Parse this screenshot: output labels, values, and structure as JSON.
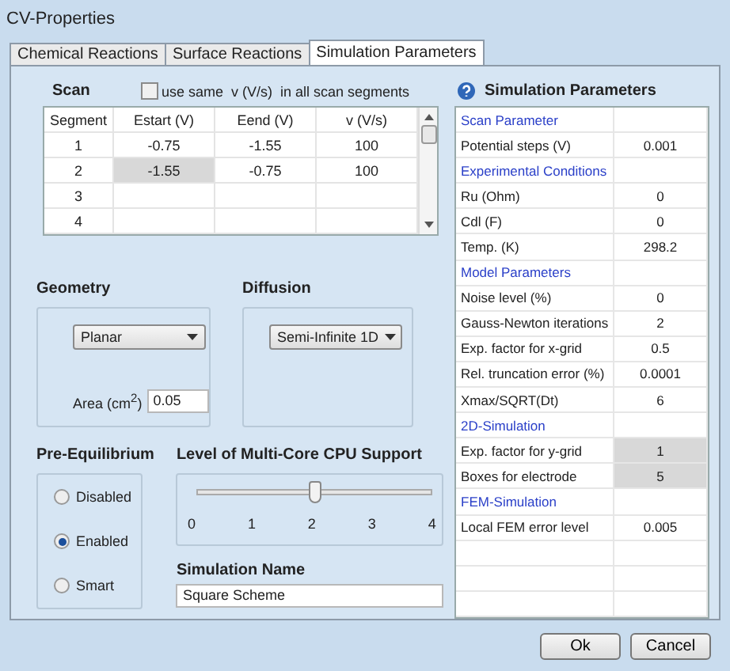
{
  "window": {
    "title": "CV-Properties"
  },
  "tabs": [
    {
      "label": "Chemical Reactions",
      "selected": false
    },
    {
      "label": "Surface Reactions",
      "selected": false
    },
    {
      "label": "Simulation Parameters",
      "selected": true
    }
  ],
  "scan": {
    "title": "Scan",
    "same_rate": {
      "label": "use same  v (V/s)  in all scan segments",
      "checked": false
    },
    "columns": [
      "Segment",
      "Estart (V)",
      "Eend (V)",
      "v (V/s)"
    ],
    "rows": [
      {
        "cells": [
          {
            "text": "1",
            "selected": false
          },
          {
            "text": "-0.75",
            "selected": false
          },
          {
            "text": "-1.55",
            "selected": false
          },
          {
            "text": "100",
            "selected": false
          }
        ]
      },
      {
        "cells": [
          {
            "text": "2",
            "selected": false
          },
          {
            "text": "-1.55",
            "selected": true
          },
          {
            "text": "-0.75",
            "selected": false
          },
          {
            "text": "100",
            "selected": false
          }
        ]
      },
      {
        "cells": [
          {
            "text": "3",
            "selected": false
          },
          {
            "text": "",
            "selected": false
          },
          {
            "text": "",
            "selected": false
          },
          {
            "text": "",
            "selected": false
          }
        ]
      },
      {
        "cells": [
          {
            "text": "4",
            "selected": false
          },
          {
            "text": "",
            "selected": false
          },
          {
            "text": "",
            "selected": false
          },
          {
            "text": "",
            "selected": false
          }
        ]
      }
    ]
  },
  "geometry": {
    "title": "Geometry",
    "value": "Planar",
    "area_label": "Area (cm$^{2}$)",
    "area_value": "0.05"
  },
  "diffusion": {
    "title": "Diffusion",
    "value": "Semi-Infinite 1D"
  },
  "pre_equilibrium": {
    "title": "Pre-Equilibrium",
    "options": [
      {
        "label": "Disabled",
        "selected": false
      },
      {
        "label": "Enabled",
        "selected": true
      },
      {
        "label": "Smart",
        "selected": false
      }
    ]
  },
  "cpu_support": {
    "title": "Level of Multi-Core CPU Support",
    "level": 0.5,
    "ticks": [
      "0",
      "1",
      "2",
      "3",
      "4"
    ]
  },
  "simulation_name": {
    "title": "Simulation Name",
    "value": "Square Scheme"
  },
  "parameters": {
    "title": "Simulation Parameters",
    "rows": [
      {
        "kind": "section",
        "label": "Scan Parameter"
      },
      {
        "kind": "param",
        "label": "Potential steps (V)",
        "value": "0.001",
        "selected": false
      },
      {
        "kind": "section",
        "label": "Experimental Conditions"
      },
      {
        "kind": "param",
        "label": "Ru (Ohm)",
        "value": "0",
        "selected": false
      },
      {
        "kind": "param",
        "label": "Cdl (F)",
        "value": "0",
        "selected": false
      },
      {
        "kind": "param",
        "label": "Temp. (K)",
        "value": "298.2",
        "selected": false
      },
      {
        "kind": "section",
        "label": "Model Parameters"
      },
      {
        "kind": "param",
        "label": "Noise level (%)",
        "value": "0",
        "selected": false
      },
      {
        "kind": "param",
        "label": "Gauss-Newton iterations",
        "value": "2",
        "selected": false
      },
      {
        "kind": "param",
        "label": "Exp. factor for x-grid",
        "value": "0.5",
        "selected": false
      },
      {
        "kind": "param",
        "label": "Rel. truncation error (%)",
        "value": "0.0001",
        "selected": false
      },
      {
        "kind": "param",
        "label": "Xmax/SQRT(Dt)",
        "value": "6",
        "selected": false
      },
      {
        "kind": "section",
        "label": "2D-Simulation"
      },
      {
        "kind": "param",
        "label": "Exp. factor for y-grid",
        "value": "1",
        "selected": true
      },
      {
        "kind": "param",
        "label": "Boxes for electrode",
        "value": "5",
        "selected": true
      },
      {
        "kind": "section",
        "label": "FEM-Simulation"
      },
      {
        "kind": "param",
        "label": "Local FEM error level",
        "value": "0.005",
        "selected": false
      },
      {
        "kind": "empty"
      },
      {
        "kind": "empty"
      },
      {
        "kind": "empty"
      }
    ]
  },
  "buttons": [
    "Ok",
    "Cancel"
  ]
}
